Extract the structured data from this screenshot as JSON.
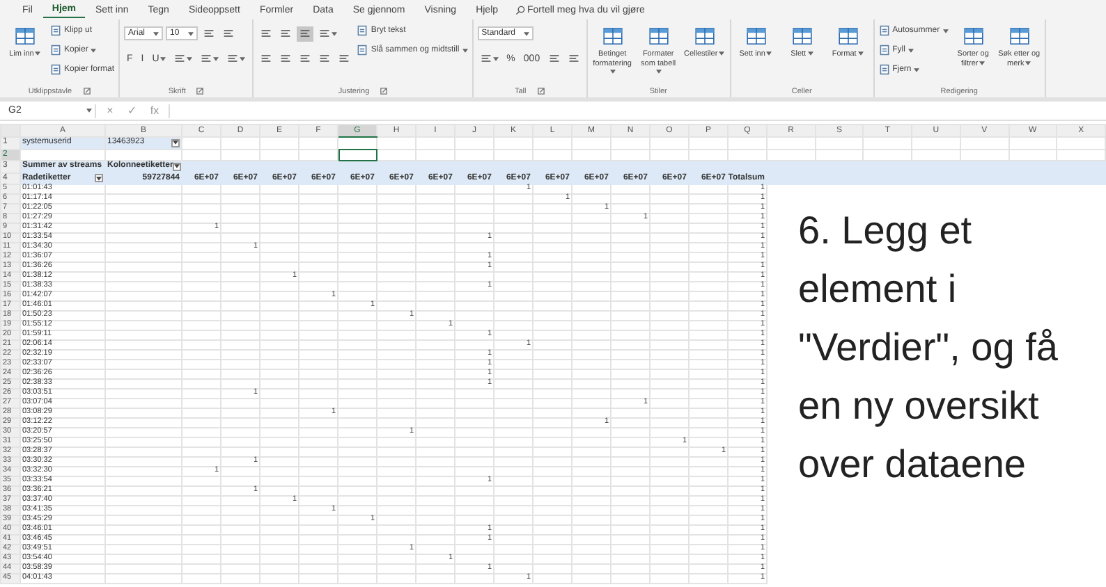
{
  "tabs": [
    {
      "label": "Fil",
      "selected": false
    },
    {
      "label": "Hjem",
      "selected": true
    },
    {
      "label": "Sett inn",
      "selected": false
    },
    {
      "label": "Tegn",
      "selected": false
    },
    {
      "label": "Sideoppsett",
      "selected": false
    },
    {
      "label": "Formler",
      "selected": false
    },
    {
      "label": "Data",
      "selected": false
    },
    {
      "label": "Se gjennom",
      "selected": false
    },
    {
      "label": "Visning",
      "selected": false
    },
    {
      "label": "Hjelp",
      "selected": false
    }
  ],
  "tell_me": "Fortell meg hva du vil gjøre",
  "ribbon": {
    "groups": [
      {
        "label": "Utklippstavle",
        "launcher": true,
        "columns": [
          [
            {
              "kind": "large",
              "label": "Lim inn",
              "menu": true
            }
          ],
          [
            {
              "kind": "small",
              "label": "Klipp ut",
              "menu": false
            },
            {
              "kind": "small",
              "label": "Kopier",
              "menu": true
            },
            {
              "kind": "small",
              "label": "Kopier format",
              "menu": false
            }
          ]
        ]
      },
      {
        "label": "Skrift",
        "launcher": true,
        "columns": [
          [
            {
              "kind": "tools",
              "buttons": [
                {
                  "kind": "select",
                  "value": "Arial"
                },
                {
                  "kind": "select",
                  "value": "10"
                },
                {
                  "kind": "icon",
                  "menu": false,
                  "selected": false
                },
                {
                  "kind": "icon",
                  "menu": false,
                  "selected": false
                }
              ]
            },
            {
              "kind": "tools",
              "buttons": [
                {
                  "kind": "text",
                  "label": "F",
                  "menu": false
                },
                {
                  "kind": "text",
                  "label": "I",
                  "menu": false
                },
                {
                  "kind": "text",
                  "label": "U",
                  "menu": true
                },
                {
                  "kind": "icon",
                  "menu": true,
                  "selected": false
                },
                {
                  "kind": "icon",
                  "menu": true,
                  "selected": false
                },
                {
                  "kind": "icon",
                  "menu": true,
                  "selected": false
                }
              ]
            }
          ]
        ]
      },
      {
        "label": "Justering",
        "launcher": true,
        "columns": [
          [
            {
              "kind": "tools",
              "buttons": [
                {
                  "kind": "icon",
                  "menu": false,
                  "selected": false
                },
                {
                  "kind": "icon",
                  "menu": false,
                  "selected": false
                },
                {
                  "kind": "icon",
                  "menu": false,
                  "selected": true
                },
                {
                  "kind": "icon",
                  "menu": true,
                  "selected": false
                }
              ]
            },
            {
              "kind": "tools",
              "buttons": [
                {
                  "kind": "icon",
                  "menu": false,
                  "selected": false
                },
                {
                  "kind": "icon",
                  "menu": false,
                  "selected": false
                },
                {
                  "kind": "icon",
                  "menu": false,
                  "selected": false
                },
                {
                  "kind": "icon",
                  "menu": false,
                  "selected": false
                },
                {
                  "kind": "icon",
                  "menu": false,
                  "selected": false
                }
              ]
            }
          ],
          [
            {
              "kind": "small",
              "label": "Bryt tekst",
              "menu": false
            },
            {
              "kind": "small",
              "label": "Slå sammen og midtstill",
              "menu": true
            }
          ]
        ]
      },
      {
        "label": "Tall",
        "launcher": true,
        "columns": [
          [
            {
              "kind": "tools",
              "buttons": [
                {
                  "kind": "select",
                  "value": "Standard"
                }
              ]
            },
            {
              "kind": "tools",
              "buttons": [
                {
                  "kind": "icon",
                  "menu": true,
                  "selected": false
                },
                {
                  "kind": "text",
                  "label": "%",
                  "menu": false
                },
                {
                  "kind": "text",
                  "label": "000",
                  "menu": false
                },
                {
                  "kind": "icon",
                  "menu": false,
                  "selected": false
                },
                {
                  "kind": "icon",
                  "menu": false,
                  "selected": false
                }
              ]
            }
          ]
        ]
      },
      {
        "label": "Stiler",
        "launcher": false,
        "columns": [
          [
            {
              "kind": "large",
              "label": "Betinget formatering",
              "menu": true
            }
          ],
          [
            {
              "kind": "large",
              "label": "Formater som tabell",
              "menu": true
            }
          ],
          [
            {
              "kind": "large",
              "label": "Cellestiler",
              "menu": true
            }
          ]
        ]
      },
      {
        "label": "Celler",
        "launcher": false,
        "columns": [
          [
            {
              "kind": "large",
              "label": "Sett inn",
              "menu": true
            }
          ],
          [
            {
              "kind": "large",
              "label": "Slett",
              "menu": true
            }
          ],
          [
            {
              "kind": "large",
              "label": "Format",
              "menu": true
            }
          ]
        ]
      },
      {
        "label": "Redigering",
        "launcher": false,
        "columns": [
          [
            {
              "kind": "small",
              "label": "Autosummer",
              "menu": true
            },
            {
              "kind": "small",
              "label": "Fyll",
              "menu": true
            },
            {
              "kind": "small",
              "label": "Fjern",
              "menu": true
            }
          ],
          [
            {
              "kind": "large",
              "label": "Sorter og filtrer",
              "menu": true
            }
          ],
          [
            {
              "kind": "large",
              "label": "Søk etter og merk",
              "menu": true
            }
          ]
        ]
      }
    ]
  },
  "formula_bar": {
    "name_box": "G2",
    "buttons": [
      "×",
      "✓",
      "fx"
    ]
  },
  "sheet": {
    "columns": [
      {
        "label": "A",
        "selected": false
      },
      {
        "label": "B",
        "selected": false
      },
      {
        "label": "C",
        "selected": false
      },
      {
        "label": "D",
        "selected": false
      },
      {
        "label": "E",
        "selected": false
      },
      {
        "label": "F",
        "selected": false
      },
      {
        "label": "G",
        "selected": true
      },
      {
        "label": "H",
        "selected": false
      },
      {
        "label": "I",
        "selected": false
      },
      {
        "label": "J",
        "selected": false
      },
      {
        "label": "K",
        "selected": false
      },
      {
        "label": "L",
        "selected": false
      },
      {
        "label": "M",
        "selected": false
      },
      {
        "label": "N",
        "selected": false
      },
      {
        "label": "O",
        "selected": false
      },
      {
        "label": "P",
        "selected": false
      },
      {
        "label": "Q",
        "selected": false
      }
    ],
    "side_columns": [
      {
        "label": "R",
        "selected": false
      },
      {
        "label": "S",
        "selected": false
      },
      {
        "label": "T",
        "selected": false
      },
      {
        "label": "U",
        "selected": false
      },
      {
        "label": "V",
        "selected": false
      },
      {
        "label": "W",
        "selected": false
      },
      {
        "label": "X",
        "selected": false
      }
    ],
    "header_rows": [
      {
        "number": "1",
        "selected": false,
        "band": false,
        "cells": {
          "A": {
            "text": "systemuserid",
            "left": true,
            "shaded": true
          },
          "B": {
            "text": "13463923",
            "left": true,
            "shaded": true,
            "filter": true
          }
        }
      },
      {
        "number": "2",
        "selected": true,
        "band": false,
        "cells": {
          "G": {
            "selected": true
          }
        }
      },
      {
        "number": "3",
        "selected": false,
        "band": true,
        "cells": {
          "A": {
            "text": "Summer av streams",
            "left": true
          },
          "B": {
            "text": "Kolonneetiketter",
            "left": true,
            "filter": true
          }
        }
      },
      {
        "number": "4",
        "selected": false,
        "band": true,
        "cells": {
          "A": {
            "text": "Radetiketter",
            "left": true,
            "filter": true
          },
          "B": {
            "text": "59727844"
          },
          "C": {
            "text": "6E+07"
          },
          "D": {
            "text": "6E+07"
          },
          "E": {
            "text": "6E+07"
          },
          "F": {
            "text": "6E+07"
          },
          "G": {
            "text": "6E+07"
          },
          "H": {
            "text": "6E+07"
          },
          "I": {
            "text": "6E+07"
          },
          "J": {
            "text": "6E+07"
          },
          "K": {
            "text": "6E+07"
          },
          "L": {
            "text": "6E+07"
          },
          "M": {
            "text": "6E+07"
          },
          "N": {
            "text": "6E+07"
          },
          "O": {
            "text": "6E+07"
          },
          "P": {
            "text": "6E+07"
          },
          "Q": {
            "text": "Totalsum"
          }
        }
      }
    ],
    "data_rows": [
      {
        "number": "5",
        "cells": {
          "A": "01:01:43",
          "K": "1",
          "Q": "1"
        }
      },
      {
        "number": "6",
        "cells": {
          "A": "01:17:14",
          "L": "1",
          "Q": "1"
        }
      },
      {
        "number": "7",
        "cells": {
          "A": "01:22:05",
          "M": "1",
          "Q": "1"
        }
      },
      {
        "number": "8",
        "cells": {
          "A": "01:27:29",
          "N": "1",
          "Q": "1"
        }
      },
      {
        "number": "9",
        "cells": {
          "A": "01:31:42",
          "C": "1",
          "Q": "1"
        }
      },
      {
        "number": "10",
        "cells": {
          "A": "01:33:54",
          "J": "1",
          "Q": "1"
        }
      },
      {
        "number": "11",
        "cells": {
          "A": "01:34:30",
          "D": "1",
          "Q": "1"
        }
      },
      {
        "number": "12",
        "cells": {
          "A": "01:36:07",
          "J": "1",
          "Q": "1"
        }
      },
      {
        "number": "13",
        "cells": {
          "A": "01:36:26",
          "J": "1",
          "Q": "1"
        }
      },
      {
        "number": "14",
        "cells": {
          "A": "01:38:12",
          "E": "1",
          "Q": "1"
        }
      },
      {
        "number": "15",
        "cells": {
          "A": "01:38:33",
          "J": "1",
          "Q": "1"
        }
      },
      {
        "number": "16",
        "cells": {
          "A": "01:42:07",
          "F": "1",
          "Q": "1"
        }
      },
      {
        "number": "17",
        "cells": {
          "A": "01:46:01",
          "G": "1",
          "Q": "1"
        }
      },
      {
        "number": "18",
        "cells": {
          "A": "01:50:23",
          "H": "1",
          "Q": "1"
        }
      },
      {
        "number": "19",
        "cells": {
          "A": "01:55:12",
          "I": "1",
          "Q": "1"
        }
      },
      {
        "number": "20",
        "cells": {
          "A": "01:59:11",
          "J": "1",
          "Q": "1"
        }
      },
      {
        "number": "21",
        "cells": {
          "A": "02:06:14",
          "K": "1",
          "Q": "1"
        }
      },
      {
        "number": "22",
        "cells": {
          "A": "02:32:19",
          "J": "1",
          "Q": "1"
        }
      },
      {
        "number": "23",
        "cells": {
          "A": "02:33:07",
          "J": "1",
          "Q": "1"
        }
      },
      {
        "number": "24",
        "cells": {
          "A": "02:36:26",
          "J": "1",
          "Q": "1"
        }
      },
      {
        "number": "25",
        "cells": {
          "A": "02:38:33",
          "J": "1",
          "Q": "1"
        }
      },
      {
        "number": "26",
        "cells": {
          "A": "03:03:51",
          "D": "1",
          "Q": "1"
        }
      },
      {
        "number": "27",
        "cells": {
          "A": "03:07:04",
          "N": "1",
          "Q": "1"
        }
      },
      {
        "number": "28",
        "cells": {
          "A": "03:08:29",
          "F": "1",
          "Q": "1"
        }
      },
      {
        "number": "29",
        "cells": {
          "A": "03:12:22",
          "M": "1",
          "Q": "1"
        }
      },
      {
        "number": "30",
        "cells": {
          "A": "03:20:57",
          "H": "1",
          "Q": "1"
        }
      },
      {
        "number": "31",
        "cells": {
          "A": "03:25:50",
          "O": "1",
          "Q": "1"
        }
      },
      {
        "number": "32",
        "cells": {
          "A": "03:28:37",
          "P": "1",
          "Q": "1"
        }
      },
      {
        "number": "33",
        "cells": {
          "A": "03:30:32",
          "D": "1",
          "Q": "1"
        }
      },
      {
        "number": "34",
        "cells": {
          "A": "03:32:30",
          "C": "1",
          "Q": "1"
        }
      },
      {
        "number": "35",
        "cells": {
          "A": "03:33:54",
          "J": "1",
          "Q": "1"
        }
      },
      {
        "number": "36",
        "cells": {
          "A": "03:36:21",
          "D": "1",
          "Q": "1"
        }
      },
      {
        "number": "37",
        "cells": {
          "A": "03:37:40",
          "E": "1",
          "Q": "1"
        }
      },
      {
        "number": "38",
        "cells": {
          "A": "03:41:35",
          "F": "1",
          "Q": "1"
        }
      },
      {
        "number": "39",
        "cells": {
          "A": "03:45:29",
          "G": "1",
          "Q": "1"
        }
      },
      {
        "number": "40",
        "cells": {
          "A": "03:46:01",
          "J": "1",
          "Q": "1"
        }
      },
      {
        "number": "41",
        "cells": {
          "A": "03:46:45",
          "J": "1",
          "Q": "1"
        }
      },
      {
        "number": "42",
        "cells": {
          "A": "03:49:51",
          "H": "1",
          "Q": "1"
        }
      },
      {
        "number": "43",
        "cells": {
          "A": "03:54:40",
          "I": "1",
          "Q": "1"
        }
      },
      {
        "number": "44",
        "cells": {
          "A": "03:58:39",
          "J": "1",
          "Q": "1"
        }
      },
      {
        "number": "45",
        "cells": {
          "A": "04:01:43",
          "K": "1",
          "Q": "1"
        }
      }
    ]
  },
  "caption": "6. Legg et element i \"Verdier\", og få en ny oversikt over dataene"
}
